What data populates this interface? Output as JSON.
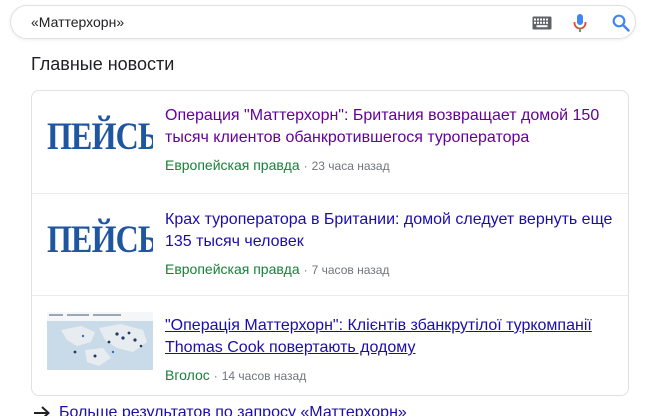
{
  "search": {
    "value": "«Маттерхорн»"
  },
  "icons": {
    "keyboard": "keyboard-icon",
    "mic": "mic-icon",
    "search": "search-icon",
    "arrow": "arrow-right-icon"
  },
  "colors": {
    "link": "#1a0dab",
    "visited_link": "#660099",
    "source": "#188038",
    "meta": "#70757a",
    "logo": "#1e56a0",
    "mic_blue": "#4285f4",
    "mic_red": "#ea4335"
  },
  "top_stories": {
    "title": "Главные новости",
    "items": [
      {
        "logo_text": "ПЕЙСЫ",
        "headline": "Операция \"Маттерхорн\": Британия возвращает домой 150 тысяч клиентов обанкротившегося туроператора",
        "source": "Европейская правда",
        "separator": "·",
        "time": "23 часа назад",
        "visited": true
      },
      {
        "logo_text": "ПЕЙСЫ",
        "headline": "Крах туроператора в Британии: домой следует вернуть еще 135 тысяч человек",
        "source": "Европейская правда",
        "separator": "·",
        "time": "7 часов назад",
        "visited": false
      },
      {
        "thumbnail": "map-thumbnail",
        "headline": "\"Операція Маттерхорн\": Клієнтів збанкрутілої туркомпанії Thomas Cook повертають додому",
        "source": "Вголос",
        "separator": "·",
        "time": "14 часов назад",
        "visited": false
      }
    ]
  },
  "more_results": {
    "label": "Больше результатов по запросу «Маттерхорн»"
  }
}
